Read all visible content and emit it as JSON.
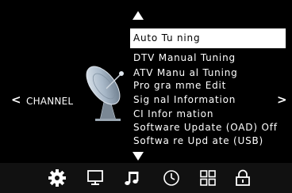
{
  "category": "CHANNEL",
  "nav": {
    "left_arrow": "<",
    "right_arrow": ">"
  },
  "menu": {
    "items": [
      {
        "label": "Auto Tu ning",
        "selected": true
      },
      {
        "label": "DTV Manual Tuning",
        "selected": false
      },
      {
        "label": "ATV Manu al Tuning",
        "selected": false
      },
      {
        "label": "Pro gra mme Edit",
        "selected": false
      },
      {
        "label": "Sig nal Information",
        "selected": false
      },
      {
        "label": "CI Infor mation",
        "selected": false
      },
      {
        "label": "Software Update (OAD) Off",
        "selected": false
      },
      {
        "label": "Softwa re Upd ate (USB)",
        "selected": false
      }
    ]
  },
  "tabs": [
    {
      "icon": "gear-icon",
      "active": true
    },
    {
      "icon": "monitor-icon",
      "active": false
    },
    {
      "icon": "music-note-icon",
      "active": false
    },
    {
      "icon": "clock-icon",
      "active": false
    },
    {
      "icon": "grid-icon",
      "active": false
    },
    {
      "icon": "lock-icon",
      "active": false
    }
  ],
  "colors": {
    "background": "#000000",
    "text": "#ffffff",
    "selected_bg": "#ffffff",
    "selected_text": "#000000",
    "bar_bg": "#111111"
  }
}
